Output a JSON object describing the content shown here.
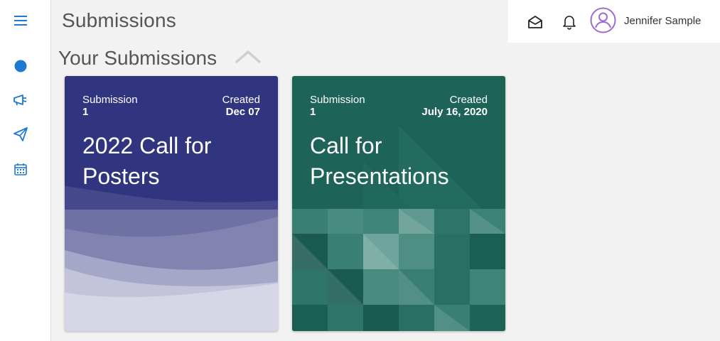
{
  "page": {
    "title": "Submissions"
  },
  "section": {
    "title": "Your Submissions"
  },
  "topbar": {
    "user_name": "Jennifer Sample"
  },
  "sidebar": {
    "items": [
      {
        "icon": "menu-icon"
      },
      {
        "icon": "circle-icon"
      },
      {
        "icon": "megaphone-icon"
      },
      {
        "icon": "paper-plane-icon"
      },
      {
        "icon": "calendar-icon"
      }
    ]
  },
  "cards": [
    {
      "submission_label": "Submission",
      "submission_value": "1",
      "created_label": "Created",
      "created_value": "Dec 07",
      "title": "2022 Call for Posters",
      "color": "#313580"
    },
    {
      "submission_label": "Submission",
      "submission_value": "1",
      "created_label": "Created",
      "created_value": "July 16, 2020",
      "title": "Call for Presentations",
      "color": "#1d6357"
    }
  ],
  "colors": {
    "accent": "#2a7ae2",
    "avatar": "#9b6cd1",
    "sidebar_icon": "#1f78d1"
  }
}
